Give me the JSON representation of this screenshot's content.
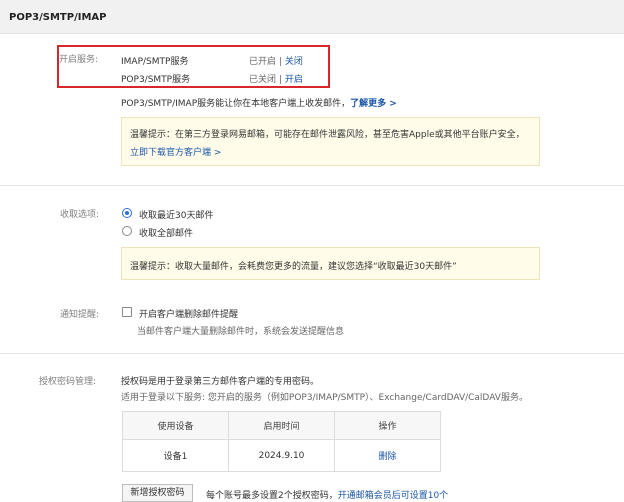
{
  "header": {
    "title": "POP3/SMTP/IMAP"
  },
  "services": {
    "label": "开启服务:",
    "items": [
      {
        "name": "IMAP/SMTP服务",
        "status": "已开启",
        "sep": "|",
        "action": "关闭"
      },
      {
        "name": "POP3/SMTP服务",
        "status": "已关闭",
        "sep": "|",
        "action": "开启"
      }
    ],
    "desc": "POP3/SMTP/IMAP服务能让你在本地客户端上收发邮件，",
    "learn_more": "了解更多 >",
    "tip": "温馨提示：在第三方登录网易邮箱，可能存在邮件泄露风险，甚至危害Apple或其他平台账户安全，",
    "tip_link": "立即下载官方客户端 >"
  },
  "receive": {
    "label": "收取选项:",
    "options": [
      {
        "label": "收取最近30天邮件",
        "checked": true
      },
      {
        "label": "收取全部邮件",
        "checked": false
      }
    ],
    "tip": "温馨提示：收取大量邮件，会耗费您更多的流量，建议您选择“收取最近30天邮件”"
  },
  "notify": {
    "label": "通知提醒:",
    "checkbox_label": "开启客户端删除邮件提醒",
    "desc": "当邮件客户端大量删除邮件时，系统会发送提醒信息"
  },
  "auth": {
    "label": "授权密码管理:",
    "desc1": "授权码是用于登录第三方邮件客户端的专用密码。",
    "desc2": "适用于登录以下服务: 您开启的服务（例如POP3/IMAP/SMTP）、Exchange/CardDAV/CalDAV服务。",
    "table": {
      "headers": [
        "使用设备",
        "启用时间",
        "操作"
      ],
      "rows": [
        {
          "device": "设备1",
          "time": "2024.9.10",
          "action": "删除"
        }
      ]
    },
    "add_button": "新增授权密码",
    "footer_text": "每个账号最多设置2个授权密码，",
    "footer_link": "开通邮箱会员后可设置10个"
  }
}
